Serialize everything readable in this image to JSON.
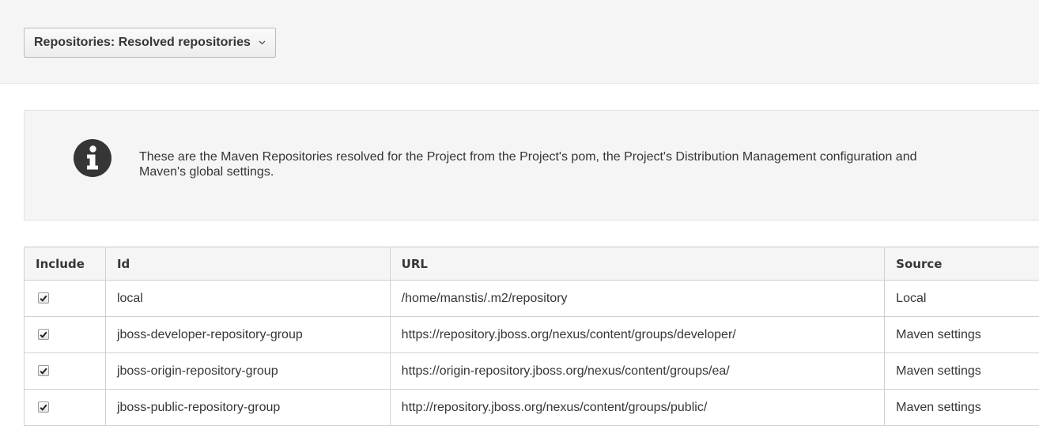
{
  "toolbar": {
    "dropdown_label": "Repositories: Resolved repositories",
    "dropdown_icon": "chevron-down-icon"
  },
  "info": {
    "icon": "info-icon",
    "text": "These are the Maven Repositories resolved for the Project from the Project's pom, the Project's Distribution Management configuration and Maven's global settings."
  },
  "table": {
    "headers": [
      "Include",
      "Id",
      "URL",
      "Source"
    ],
    "rows": [
      {
        "include": true,
        "id": "local",
        "url": "/home/manstis/.m2/repository",
        "source": "Local"
      },
      {
        "include": true,
        "id": "jboss-developer-repository-group",
        "url": "https://repository.jboss.org/nexus/content/groups/developer/",
        "source": "Maven settings"
      },
      {
        "include": true,
        "id": "jboss-origin-repository-group",
        "url": "https://origin-repository.jboss.org/nexus/content/groups/ea/",
        "source": "Maven settings"
      },
      {
        "include": true,
        "id": "jboss-public-repository-group",
        "url": "http://repository.jboss.org/nexus/content/groups/public/",
        "source": "Maven settings"
      }
    ]
  }
}
